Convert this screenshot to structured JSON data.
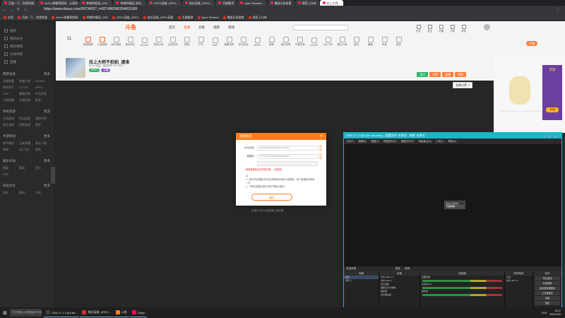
{
  "browser": {
    "url": "https://www.douyu.com/9973403?_t=827496090354603189",
    "tabs": [
      {
        "label": "百度一下，你就知道",
        "active": false
      },
      {
        "label": "AcFun弹幕视频网 - 认真你就输啦",
        "active": false
      },
      {
        "label": "神域种植园_DNF...",
        "active": false
      },
      {
        "label": "神域种植园-游戏...",
        "active": false
      },
      {
        "label": "APEX英雄_APEX...",
        "active": false
      },
      {
        "label": "指尖英雄_APEX...",
        "active": false
      },
      {
        "label": "百度翻译",
        "active": false
      },
      {
        "label": "Apex Ranked...",
        "active": false
      },
      {
        "label": "播放记录查看",
        "active": false
      },
      {
        "label": "搜索上分神",
        "active": false
      },
      {
        "label": "拉上大师...",
        "active": true
      }
    ],
    "bookmarks": [
      "应用",
      "百度一下，你就知道",
      "AcFun弹幕视频网",
      "神域种植园_DNF",
      "APEX英雄_APEX",
      "指尖英雄_APEX英雄",
      "百度翻译",
      "Apex Ranked",
      "播放记录查看",
      "搜索上分神"
    ]
  },
  "sidebar": {
    "items": [
      "推荐",
      "我的关注",
      "我的视频",
      "分类导航",
      "直播"
    ],
    "groups": [
      {
        "title": "网游竞技",
        "more": "更多",
        "entries": [
          "英雄联盟",
          "穿越火线",
          "DOTA2",
          "绝地求生",
          "CS:GO",
          "APEX",
          "DNF",
          "魔兽世界",
          "炉石传说",
          "王者荣耀",
          "守望先锋",
          "更多"
        ]
      },
      {
        "title": "单机热游",
        "more": "更多",
        "entries": [
          "主机游戏",
          "怀旧游戏",
          "我的世界",
          "独立游戏",
          "恐怖游戏",
          "更多"
        ]
      },
      {
        "title": "手游休闲",
        "more": "更多",
        "entries": [
          "和平精英",
          "王者荣耀",
          "第五人格",
          "原神",
          "QQ飞车",
          "更多"
        ]
      },
      {
        "title": "娱乐天地",
        "more": "更多",
        "entries": [
          "颜值",
          "舞蹈",
          "音乐",
          "户外"
        ]
      },
      {
        "title": "科技文化",
        "more": "更多",
        "entries": [
          "科技",
          "数码",
          "文化"
        ]
      }
    ]
  },
  "topnav": {
    "logo": "斗鱼",
    "live_count": "11",
    "links": [
      "首页",
      "直播",
      "分类",
      "视频",
      "游戏"
    ],
    "categories": [
      "英雄联盟",
      "王者荣耀",
      "和平精英",
      "绝地求生",
      "DOTA2",
      "穿越火线",
      "主机游戏",
      "颜值",
      "户外",
      "DNF",
      "魔兽世界",
      "炉石传说",
      "APEX",
      "原神",
      "我的世界",
      "守望先锋",
      "CS:GO",
      "QQ飞车",
      "第五人格",
      "音乐",
      "舞蹈",
      "科技",
      "更多"
    ],
    "user_links": [
      "历史",
      "关注",
      "开播",
      "下载",
      "消息"
    ],
    "action_btn": "开播"
  },
  "room": {
    "title": "拉上大师不拍拍_速来",
    "meta": "APEX英雄 · 直播间号 9973403",
    "tags": [
      "APEX",
      "主播"
    ],
    "btn_follow": "关注",
    "btn_share": "分享",
    "btn_record": "录播",
    "btn_report": "举报",
    "record_button": "直播设置",
    "side_title": "贵族",
    "side_btn": "开通"
  },
  "modal": {
    "title": "直播推流",
    "close": "×",
    "rtmp_label": "rtmp地址",
    "rtmp_value": "rtmp://sendtc3.douyu.com/live",
    "code_label": "直播码",
    "code_value": "9973403rPDWPAi3aZaa6ewm",
    "code_value2": "",
    "copy": "复制",
    "refresh_note": "刷新直播码后请重新开播，一键复制",
    "notice_title": "注：",
    "notice_1": "1、每次开启直播请先在此获取推流地址与直播码，每个直播码仅使用一次",
    "notice_2": "2、不能在直播过程中重复开播obs推流",
    "ok": "确定",
    "footer": "关播后可在斗鱼直播工具查看"
  },
  "obs": {
    "title": "OBS 27.1.3 (64-bit, windows) - 配置文件: 未命名 - 场景: 未命名",
    "menu": [
      "文件(F)",
      "编辑(E)",
      "视图(V)",
      "停靠部件(D)",
      "配置文件(P)",
      "场景集合(S)",
      "工具(T)",
      "帮助(H)"
    ],
    "popup": [
      "按住左键选择",
      "开始录制"
    ],
    "toolbar": [
      "未选择源",
      "属性",
      "滤镜"
    ],
    "docks": {
      "scenes": {
        "title": "场景",
        "items": [
          "场景",
          "场景 2"
        ]
      },
      "sources": {
        "title": "来源",
        "items": [
          "文本 (GDI+) 2",
          "文本 (GDI+)",
          "窗口采集",
          "图像幻灯片放映",
          "媒体源",
          "显示器采集"
        ]
      },
      "mixer": {
        "title": "混音器",
        "items": [
          "桌面音频",
          "麦克风/Aux",
          "媒体源"
        ]
      },
      "transitions": {
        "title": "转场特效",
        "type": "淡出",
        "duration_label": "时长",
        "duration": "300 ms"
      },
      "controls": {
        "title": "控件",
        "buttons": [
          "停止推流",
          "开始录制",
          "启动虚拟摄像机",
          "工作室模式",
          "设置",
          "退出"
        ]
      }
    },
    "status": "LIVE: 00:00:00  REC: 00:00:00  CPU: 1.3%, 60.00 fps"
  },
  "taskbar": {
    "search_placeholder": "在这里输入你要搜索的内容",
    "apps": [
      "OBS 27.1.3 (64-bit...",
      "指尖英雄_APEX...",
      "斗鱼",
      "Origin"
    ],
    "time": "19:17",
    "date": "2022/1/22",
    "ime": "ENG"
  },
  "colors": {
    "accent": "#ff7d1f",
    "obs_border": "#16b7c5",
    "follow_green": "#2fb56b"
  }
}
